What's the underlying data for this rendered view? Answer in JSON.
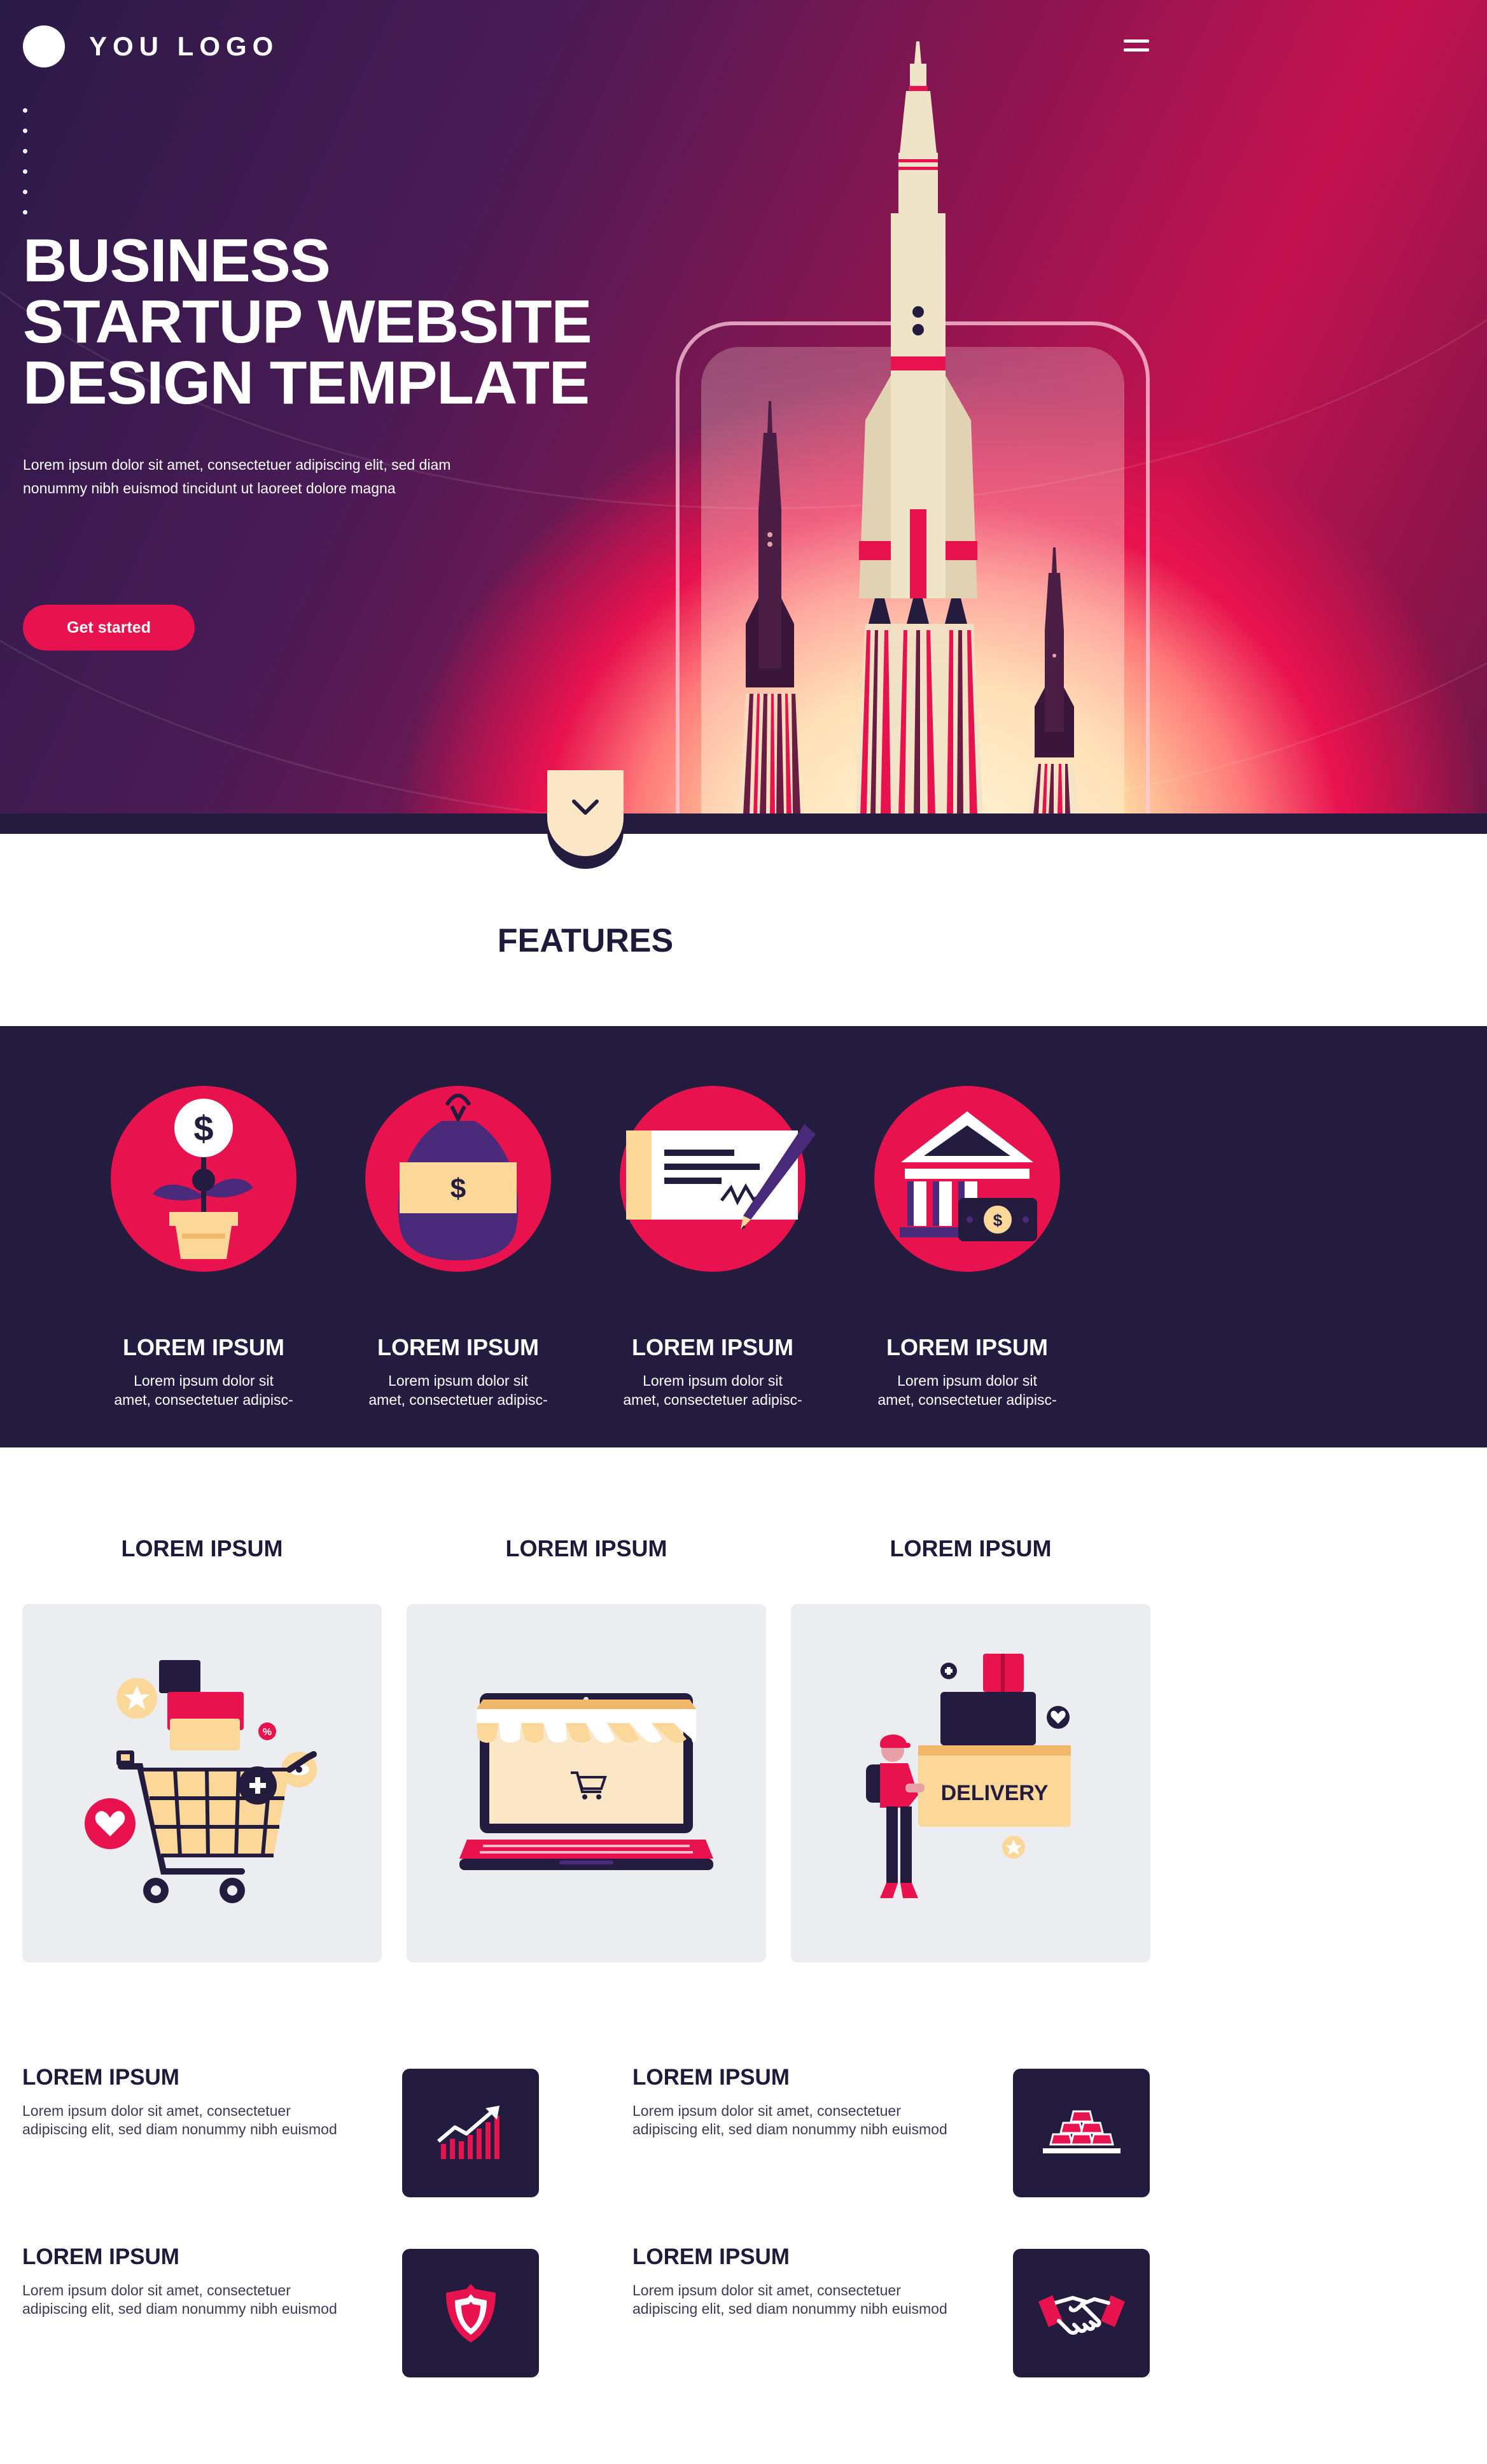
{
  "header": {
    "logo_text": "YOU LOGO"
  },
  "hero": {
    "title_line1": "BUSINESS",
    "title_line2": "STARTUP WEBSITE",
    "title_line3": "DESIGN TEMPLATE",
    "subtitle_line1": "Lorem ipsum dolor sit amet, consectetuer adipiscing elit, sed diam",
    "subtitle_line2": "nonummy nibh euismod tincidunt ut laoreet dolore magna",
    "cta_label": "Get started"
  },
  "features": {
    "title": "FEATURES",
    "items": [
      {
        "title": "LOREM IPSUM",
        "text_line1": "Lorem ipsum dolor sit",
        "text_line2": "amet, consectetuer adipisc-",
        "icon": "money-plant-icon"
      },
      {
        "title": "LOREM IPSUM",
        "text_line1": "Lorem ipsum dolor sit",
        "text_line2": "amet, consectetuer adipisc-",
        "icon": "money-bag-icon"
      },
      {
        "title": "LOREM IPSUM",
        "text_line1": "Lorem ipsum dolor sit",
        "text_line2": "amet, consectetuer adipisc-",
        "icon": "check-signing-icon"
      },
      {
        "title": "LOREM IPSUM",
        "text_line1": "Lorem ipsum dolor sit",
        "text_line2": "amet, consectetuer adipisc-",
        "icon": "bank-icon"
      }
    ]
  },
  "cards": [
    {
      "title": "LOREM IPSUM",
      "icon": "shopping-cart-icon"
    },
    {
      "title": "LOREM IPSUM",
      "icon": "online-shop-laptop-icon"
    },
    {
      "title": "LOREM IPSUM",
      "icon": "delivery-courier-icon",
      "badge": "DELIVERY"
    }
  ],
  "items": [
    {
      "title": "LOREM IPSUM",
      "text_line1": "Lorem ipsum dolor sit amet, consectetuer",
      "text_line2": "adipiscing elit, sed diam nonummy nibh euismod",
      "icon": "growth-chart-icon"
    },
    {
      "title": "LOREM IPSUM",
      "text_line1": "Lorem ipsum dolor sit amet, consectetuer",
      "text_line2": "adipiscing elit, sed diam nonummy nibh euismod",
      "icon": "gold-bars-icon"
    },
    {
      "title": "LOREM IPSUM",
      "text_line1": "Lorem ipsum dolor sit amet, consectetuer",
      "text_line2": "adipiscing elit, sed diam nonummy nibh euismod",
      "icon": "shield-icon"
    },
    {
      "title": "LOREM IPSUM",
      "text_line1": "Lorem ipsum dolor sit amet, consectetuer",
      "text_line2": "adipiscing elit, sed diam nonummy nibh euismod",
      "icon": "handshake-icon"
    }
  ],
  "colors": {
    "accent": "#e8124f",
    "dark": "#241c3f",
    "cream": "#fbe6c6",
    "card_bg": "#ecedf1"
  }
}
